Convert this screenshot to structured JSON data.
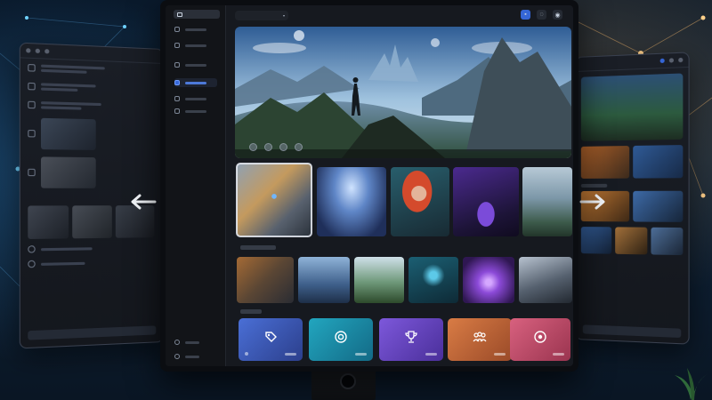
{
  "window": {
    "title": ""
  },
  "colors": {
    "accent": "#3566d6",
    "background": "#0d2238",
    "panel": "#16191f",
    "tile_blue": "#3a5bb8",
    "tile_teal": "#1b8fa6",
    "tile_purple": "#6b4bc7",
    "tile_orange": "#c46a37",
    "tile_pink": "#c85577"
  },
  "sidebar": {
    "items": [
      {
        "icon": "home-icon",
        "active": false
      },
      {
        "icon": "library-icon",
        "active": false
      },
      {
        "icon": "store-icon",
        "active": false
      },
      {
        "icon": "explore-icon",
        "active": true
      },
      {
        "icon": "friends-icon",
        "active": false
      },
      {
        "icon": "downloads-icon",
        "active": false
      }
    ],
    "bottom_items": [
      {
        "icon": "settings-icon"
      },
      {
        "icon": "profile-icon"
      }
    ]
  },
  "topbar": {
    "search_icon": "search-icon",
    "icons": [
      "grid-view-icon",
      "notification-icon",
      "user-icon"
    ]
  },
  "hero": {
    "image": "fantasy-landscape-hero",
    "carousel_count": 4
  },
  "featured_row": [
    {
      "image": "mech-robot",
      "featured": true
    },
    {
      "image": "ice-cave-warrior",
      "featured": false
    },
    {
      "image": "red-haired-heroine",
      "featured": false
    },
    {
      "image": "neon-sports-car",
      "featured": false
    },
    {
      "image": "armored-knight",
      "featured": false
    }
  ],
  "second_row": [
    {
      "image": "robot-warrior"
    },
    {
      "image": "snow-forest"
    },
    {
      "image": "green-valley"
    },
    {
      "image": "cyber-fighter"
    },
    {
      "image": "purple-portal"
    },
    {
      "image": "frost-knight"
    }
  ],
  "category_tiles": [
    {
      "icon": "tag-icon",
      "color": "#3a5bb8"
    },
    {
      "icon": "target-icon",
      "color": "#1b8fa6"
    },
    {
      "icon": "trophy-icon",
      "color": "#6b4bc7"
    },
    {
      "icon": "group-icon",
      "color": "#c46a37"
    },
    {
      "icon": "record-icon",
      "color": "#c85577"
    }
  ],
  "side_panels": {
    "left": {
      "direction_icon": "arrow-left-icon"
    },
    "right": {
      "direction_icon": "arrow-right-icon"
    }
  }
}
